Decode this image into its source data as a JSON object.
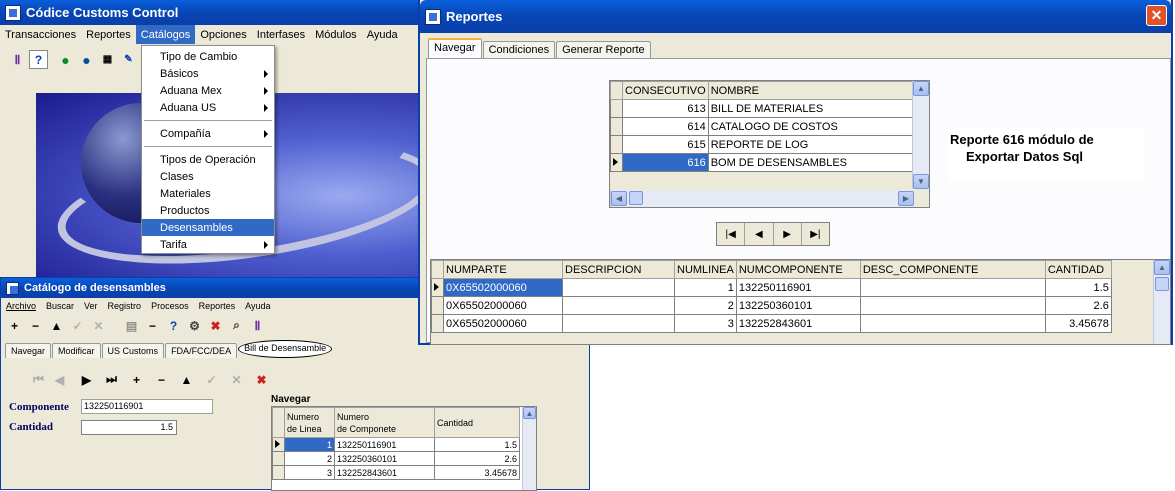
{
  "main": {
    "title": "Códice Customs Control",
    "menu": [
      "Transacciones",
      "Reportes",
      "Catálogos",
      "Opciones",
      "Interfases",
      "Módulos",
      "Ayuda"
    ]
  },
  "catalog_menu": {
    "items": [
      "Tipo de Cambio",
      "Básicos",
      "Aduana Mex",
      "Aduana US",
      "Compañía",
      "Tipos de Operación",
      "Clases",
      "Materiales",
      "Productos",
      "Desensambles",
      "Tarifa"
    ]
  },
  "desensambles": {
    "title": "Catálogo de desensambles",
    "menu": [
      "Archivo",
      "Buscar",
      "Ver",
      "Registro",
      "Procesos",
      "Reportes",
      "Ayuda"
    ],
    "tabs": [
      "Navegar",
      "Modificar",
      "US Customs",
      "FDA/FCC/DEA",
      "Bill de Desensamble"
    ],
    "componente_label": "Componente",
    "componente_value": "132250116901",
    "cantidad_label": "Cantidad",
    "cantidad_value": "1.5",
    "grid_title": "Navegar",
    "headers": [
      "Numero\nde Linea",
      "Numero\nde Componete",
      "Cantidad"
    ],
    "rows": [
      [
        "1",
        "132250116901",
        "1.5"
      ],
      [
        "2",
        "132250360101",
        "2.6"
      ],
      [
        "3",
        "132252843601",
        "3.45678"
      ]
    ]
  },
  "reportes": {
    "title": "Reportes",
    "tabs": [
      "Navegar",
      "Condiciones",
      "Generar Reporte"
    ],
    "list_headers": [
      "CONSECUTIVO",
      "NOMBRE"
    ],
    "list_rows": [
      [
        "613",
        "BILL DE MATERIALES"
      ],
      [
        "614",
        "CATALOGO DE  COSTOS"
      ],
      [
        "615",
        "REPORTE DE LOG"
      ],
      [
        "616",
        "BOM DE DESENSAMBLES"
      ]
    ],
    "note_line1": "Reporte 616 módulo de",
    "note_line2": "Exportar Datos Sql",
    "result_headers": [
      "NUMPARTE",
      "DESCRIPCION",
      "NUMLINEA",
      "NUMCOMPONENTE",
      "DESC_COMPONENTE",
      "CANTIDAD"
    ],
    "result_rows": [
      [
        "0X65502000060",
        "",
        "1",
        "132250116901",
        "",
        "1.5"
      ],
      [
        "0X65502000060",
        "",
        "2",
        "132250360101",
        "",
        "2.6"
      ],
      [
        "0X65502000060",
        "",
        "3",
        "132252843601",
        "",
        "3.45678"
      ]
    ]
  },
  "colors": {
    "title_blue": "#0a5fdc",
    "selection": "#316ac5",
    "close_red": "#e0522a"
  }
}
